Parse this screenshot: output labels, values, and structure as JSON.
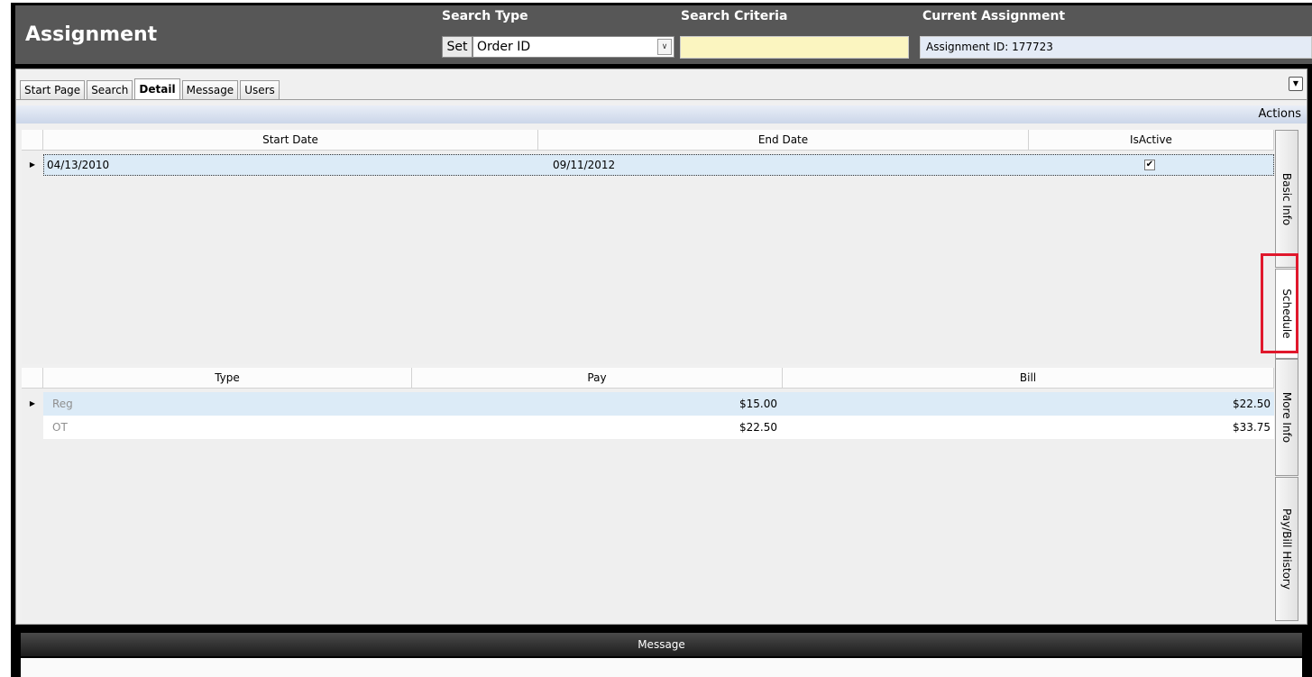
{
  "app": {
    "title": "Assignment"
  },
  "search": {
    "type_label": "Search Type",
    "set_label": "Set",
    "type_value": "Order ID",
    "criteria_label": "Search Criteria",
    "criteria_value": ""
  },
  "current": {
    "label": "Current Assignment",
    "value": "Assignment ID: 177723"
  },
  "tabs": [
    {
      "label": "Start Page"
    },
    {
      "label": "Search"
    },
    {
      "label": "Detail"
    },
    {
      "label": "Message"
    },
    {
      "label": "Users"
    }
  ],
  "actions_label": "Actions",
  "schedule_grid": {
    "columns": [
      "Start Date",
      "End Date",
      "IsActive"
    ],
    "rows": [
      {
        "start": "04/13/2010",
        "end": "09/11/2012",
        "active": "✔"
      }
    ]
  },
  "rate_grid": {
    "columns": [
      "Type",
      "Pay",
      "Bill"
    ],
    "rows": [
      {
        "type": "Reg",
        "pay": "$15.00",
        "bill": "$22.50"
      },
      {
        "type": "OT",
        "pay": "$22.50",
        "bill": "$33.75"
      }
    ]
  },
  "side_tabs": [
    {
      "label": "Basic Info"
    },
    {
      "label": "Schedule"
    },
    {
      "label": "More Info"
    },
    {
      "label": "Pay/Bill History"
    }
  ],
  "message_bar": {
    "label": "Message"
  },
  "icons": {
    "dropdown": "chevron-down-icon",
    "row_pointer": "triangle-right-icon",
    "collapse": "chevron-down-icon"
  },
  "colors": {
    "header_bg": "#575757",
    "criteria_bg": "#fbf5c0",
    "current_bg": "#e4ebf6",
    "selected_row": "#dcebf7",
    "highlight": "#e0182c"
  }
}
